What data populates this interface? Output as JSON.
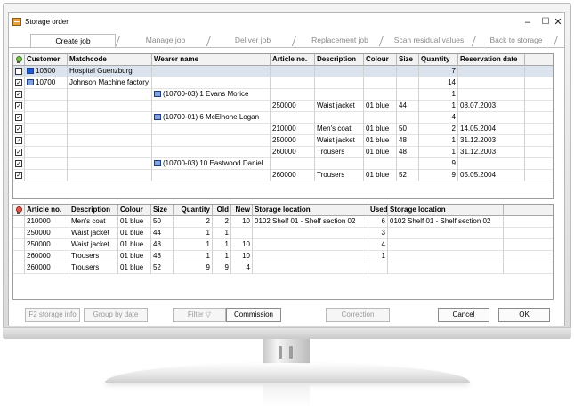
{
  "window": {
    "title": "Storage order",
    "controls": [
      "–",
      "☐",
      "✕"
    ]
  },
  "tabs": [
    {
      "label": "Create job",
      "active": true
    },
    {
      "label": "Manage job",
      "active": false
    },
    {
      "label": "Deliver job",
      "active": false
    },
    {
      "label": "Replacement job",
      "active": false
    },
    {
      "label": "Scan residual values",
      "active": false
    },
    {
      "label": "Back to storage",
      "active": false
    }
  ],
  "top_grid": {
    "columns": [
      "Customer",
      "Matchcode",
      "Wearer name",
      "Article no.",
      "Description",
      "Colour",
      "Size",
      "Quantity",
      "Reservation date"
    ],
    "rows": [
      {
        "checked": false,
        "customer": "10300",
        "matchcode": "Hospital Guenzburg",
        "wearer": "",
        "article": "",
        "description": "",
        "colour": "",
        "size": "",
        "quantity": "7",
        "date": "",
        "selected": true,
        "icon": "blue"
      },
      {
        "checked": true,
        "customer": "10700",
        "matchcode": "Johnson Machine factory",
        "wearer": "",
        "article": "",
        "description": "",
        "colour": "",
        "size": "",
        "quantity": "14",
        "date": "",
        "selected": false,
        "icon": "gray"
      },
      {
        "checked": true,
        "customer": "",
        "matchcode": "",
        "wearer": "(10700-03)  1  Evans Morice",
        "article": "",
        "description": "",
        "colour": "",
        "size": "",
        "quantity": "1",
        "date": "",
        "selected": false,
        "icon": ""
      },
      {
        "checked": true,
        "customer": "",
        "matchcode": "",
        "wearer": "",
        "article": "250000",
        "description": "Waist jacket",
        "colour": "01  blue",
        "size": "44",
        "quantity": "1",
        "date": "08.07.2003",
        "selected": false,
        "icon": ""
      },
      {
        "checked": true,
        "customer": "",
        "matchcode": "",
        "wearer": "(10700-01)  6  McElhone Logan",
        "article": "",
        "description": "",
        "colour": "",
        "size": "",
        "quantity": "4",
        "date": "",
        "selected": false,
        "icon": ""
      },
      {
        "checked": true,
        "customer": "",
        "matchcode": "",
        "wearer": "",
        "article": "210000",
        "description": "Men's coat",
        "colour": "01  blue",
        "size": "50",
        "quantity": "2",
        "date": "14.05.2004",
        "selected": false,
        "icon": ""
      },
      {
        "checked": true,
        "customer": "",
        "matchcode": "",
        "wearer": "",
        "article": "250000",
        "description": "Waist jacket",
        "colour": "01  blue",
        "size": "48",
        "quantity": "1",
        "date": "31.12.2003",
        "selected": false,
        "icon": ""
      },
      {
        "checked": true,
        "customer": "",
        "matchcode": "",
        "wearer": "",
        "article": "260000",
        "description": "Trousers",
        "colour": "01  blue",
        "size": "48",
        "quantity": "1",
        "date": "31.12.2003",
        "selected": false,
        "icon": ""
      },
      {
        "checked": true,
        "customer": "",
        "matchcode": "",
        "wearer": "(10700-03)  10  Eastwood Daniel",
        "article": "",
        "description": "",
        "colour": "",
        "size": "",
        "quantity": "9",
        "date": "",
        "selected": false,
        "icon": ""
      },
      {
        "checked": true,
        "customer": "",
        "matchcode": "",
        "wearer": "",
        "article": "260000",
        "description": "Trousers",
        "colour": "01  blue",
        "size": "52",
        "quantity": "9",
        "date": "05.05.2004",
        "selected": false,
        "icon": ""
      }
    ]
  },
  "bottom_grid": {
    "columns": [
      "Article no.",
      "Description",
      "Colour",
      "Size",
      "Quantity",
      "Old",
      "New",
      "Storage location",
      "Used",
      "Storage location"
    ],
    "rows": [
      {
        "article": "210000",
        "description": "Men's coat",
        "colour": "01  blue",
        "size": "50",
        "quantity": "2",
        "old": "2",
        "new": "10",
        "location": "0102  Shelf 01 - Shelf section 02",
        "used": "6",
        "location2": "0102  Shelf 01 - Shelf section 02"
      },
      {
        "article": "250000",
        "description": "Waist jacket",
        "colour": "01  blue",
        "size": "44",
        "quantity": "1",
        "old": "1",
        "new": "",
        "location": "",
        "used": "3",
        "location2": ""
      },
      {
        "article": "250000",
        "description": "Waist jacket",
        "colour": "01  blue",
        "size": "48",
        "quantity": "1",
        "old": "1",
        "new": "10",
        "location": "",
        "used": "4",
        "location2": ""
      },
      {
        "article": "260000",
        "description": "Trousers",
        "colour": "01  blue",
        "size": "48",
        "quantity": "1",
        "old": "1",
        "new": "10",
        "location": "",
        "used": "1",
        "location2": ""
      },
      {
        "article": "260000",
        "description": "Trousers",
        "colour": "01  blue",
        "size": "52",
        "quantity": "9",
        "old": "9",
        "new": "4",
        "location": "",
        "used": "",
        "location2": ""
      }
    ]
  },
  "buttons": {
    "storage_info": "F2 storage info",
    "group_by_date": "Group by date",
    "filter": "Filter",
    "commission": "Commission",
    "correction": "Correction",
    "cancel": "Cancel",
    "ok": "OK"
  }
}
